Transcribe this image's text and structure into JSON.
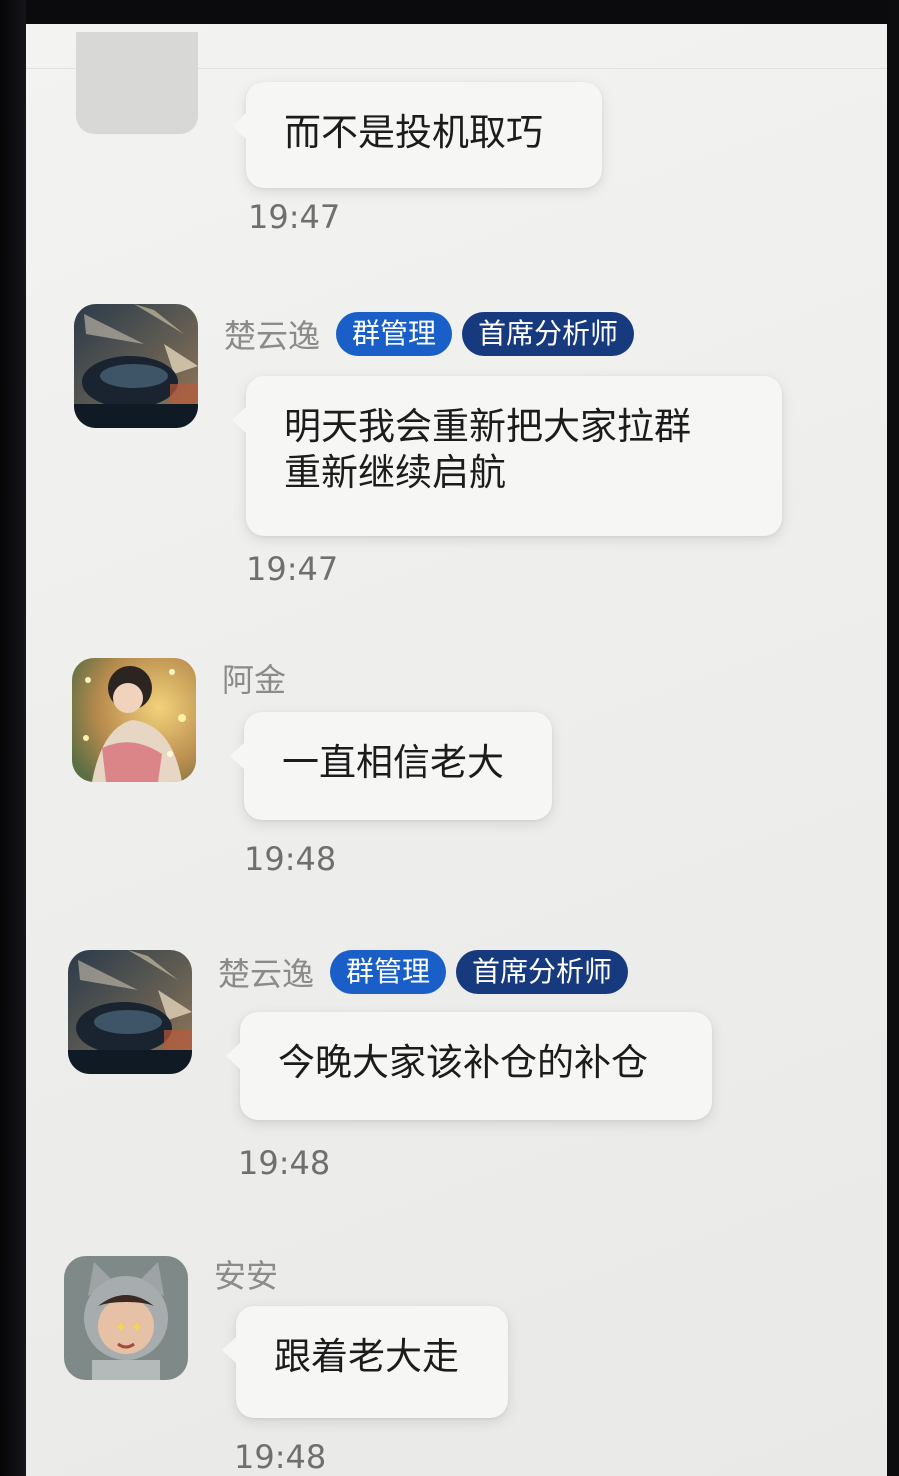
{
  "messages": [
    {
      "sender": "",
      "badges": [],
      "text": "而不是投机取巧",
      "time": "19:47",
      "avatar": "placeholder-avatar"
    },
    {
      "sender": "楚云逸",
      "badges": [
        "群管理",
        "首席分析师"
      ],
      "text": "明天我会重新把大家拉群\n重新继续启航",
      "text_lines": [
        "明天我会重新把大家拉群",
        "重新继续启航"
      ],
      "time": "19:47",
      "avatar": "car-avatar"
    },
    {
      "sender": "阿金",
      "badges": [],
      "text": "一直相信老大",
      "time": "19:48",
      "avatar": "girl-avatar"
    },
    {
      "sender": "楚云逸",
      "badges": [
        "群管理",
        "首席分析师"
      ],
      "text": "今晚大家该补仓的补仓",
      "time": "19:48",
      "avatar": "car-avatar"
    },
    {
      "sender": "安安",
      "badges": [],
      "text": "跟着老大走",
      "time": "19:48",
      "avatar": "cat-hood-child-avatar"
    }
  ],
  "colors": {
    "badge_admin": "#1a5fc8",
    "badge_analyst": "#17397e",
    "bubble": "#f6f6f5",
    "background": "#eeeeec",
    "timestamp": "#6f6f6f",
    "sender_name": "#8b8b8b"
  }
}
